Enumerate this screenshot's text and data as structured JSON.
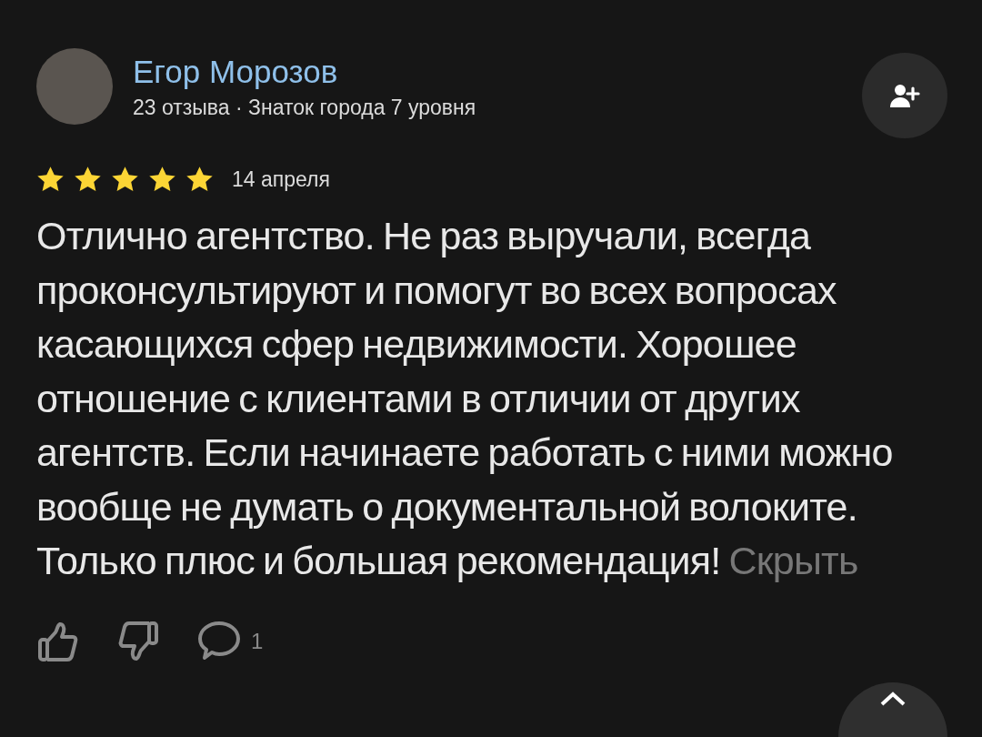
{
  "author": {
    "name": "Егор Морозов",
    "meta": "23 отзыва · Знаток города 7 уровня"
  },
  "rating": {
    "stars": 5
  },
  "date": "14 апреля",
  "review": {
    "text": "Отлично агентство. Не раз выручали, всегда проконсультируют и помогут во всех вопросах касающихся сфер недвижимости. Хорошее отношение с клиентами в отличии от других агентств. Если начинаете работать с ними можно вообще не думать о документальной волоките. Только плюс и большая рекомендация!",
    "toggle": "Скрыть"
  },
  "reactions": {
    "comments": "1"
  }
}
